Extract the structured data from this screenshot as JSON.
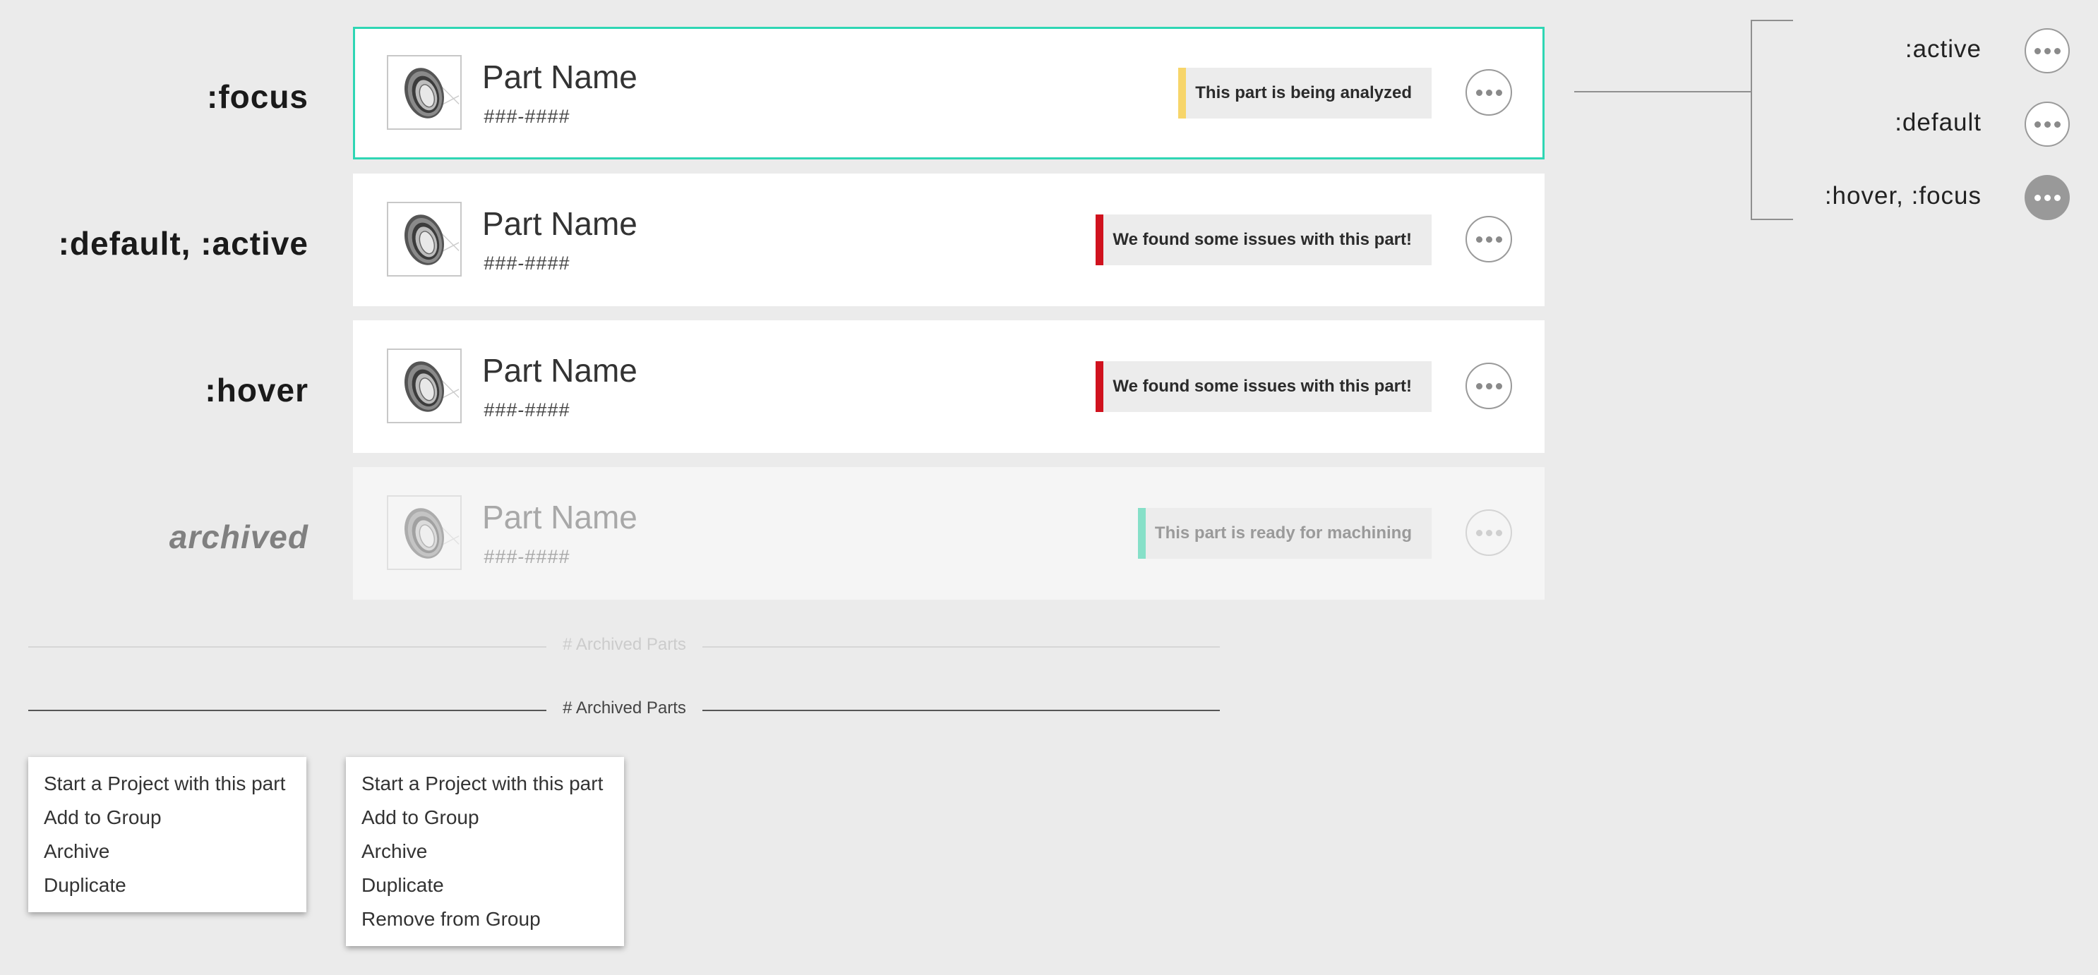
{
  "state_labels": {
    "focus": ":focus",
    "default_active": ":default, :active",
    "hover": ":hover",
    "archived": "archived"
  },
  "cards": [
    {
      "name": "Part Name",
      "number": "###-####",
      "status": "This part is being analyzed",
      "status_color": "#f7d56a"
    },
    {
      "name": "Part Name",
      "number": "###-####",
      "status": "We found some issues with this part!",
      "status_color": "#d0121e"
    },
    {
      "name": "Part Name",
      "number": "###-####",
      "status": "We found some issues with this part!",
      "status_color": "#d0121e"
    },
    {
      "name": "Part Name",
      "number": "###-####",
      "status": "This part is ready for machining",
      "status_color": "#86e0c8"
    }
  ],
  "legend": {
    "active": ":active",
    "default": ":default",
    "hover_focus": ":hover, :focus"
  },
  "dividers": {
    "faded_label": "# Archived Parts",
    "normal_label": "# Archived Parts"
  },
  "menus": [
    {
      "items": [
        "Start a Project with this part",
        "Add to Group",
        "Archive",
        "Duplicate"
      ]
    },
    {
      "items": [
        "Start a Project with this part",
        "Add to Group",
        "Archive",
        "Duplicate",
        "Remove from Group"
      ]
    }
  ],
  "colors": {
    "focus_border": "#2fd6b4",
    "background": "#ebebeb",
    "analyzing": "#f7d56a",
    "issues": "#d0121e",
    "ready": "#86e0c8"
  },
  "icons": {
    "part_thumbnail": "bearing-part-icon",
    "more_button": "more-dots-icon"
  }
}
